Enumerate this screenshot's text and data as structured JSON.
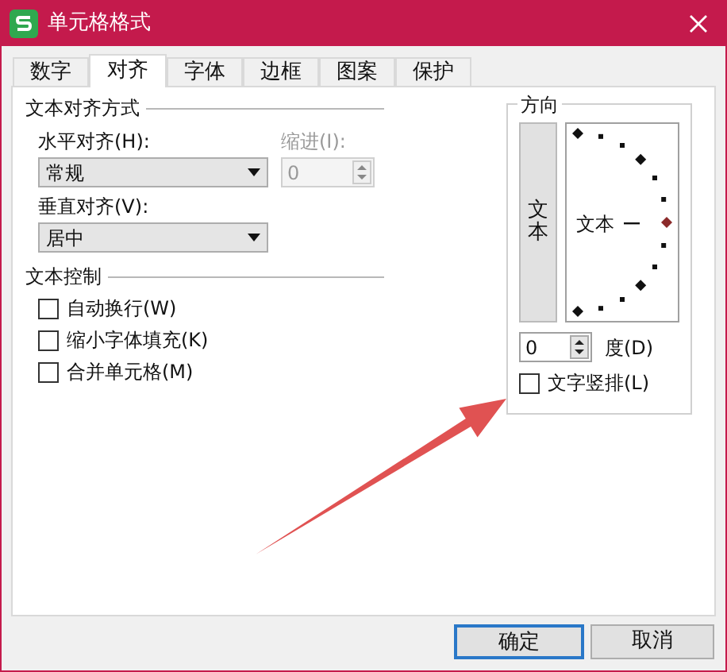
{
  "window": {
    "title": "单元格格式"
  },
  "tabs": [
    {
      "label": "数字",
      "selected": false
    },
    {
      "label": "对齐",
      "selected": true
    },
    {
      "label": "字体",
      "selected": false
    },
    {
      "label": "边框",
      "selected": false
    },
    {
      "label": "图案",
      "selected": false
    },
    {
      "label": "保护",
      "selected": false
    }
  ],
  "alignment": {
    "title": "文本对齐方式",
    "horizontal": {
      "label": "水平对齐(H):",
      "value": "常规"
    },
    "indent": {
      "label": "缩进(I):",
      "value": "0",
      "disabled": true
    },
    "vertical": {
      "label": "垂直对齐(V):",
      "value": "居中"
    }
  },
  "text_control": {
    "title": "文本控制",
    "options": [
      {
        "label": "自动换行(W)",
        "checked": false
      },
      {
        "label": "缩小字体填充(K)",
        "checked": false
      },
      {
        "label": "合并单元格(M)",
        "checked": false
      }
    ]
  },
  "orientation": {
    "title": "方向",
    "vertical_text": {
      "label": "文本",
      "selected": false
    },
    "dial_text": "文本",
    "degrees": "0",
    "degrees_label": "度(D)",
    "stacked": {
      "label": "文字竖排(L)",
      "checked": false
    }
  },
  "annotations": [
    {
      "kind": "arrow"
    }
  ],
  "buttons": [
    {
      "label": "确定",
      "default": true
    },
    {
      "label": "取消",
      "default": false
    }
  ]
}
